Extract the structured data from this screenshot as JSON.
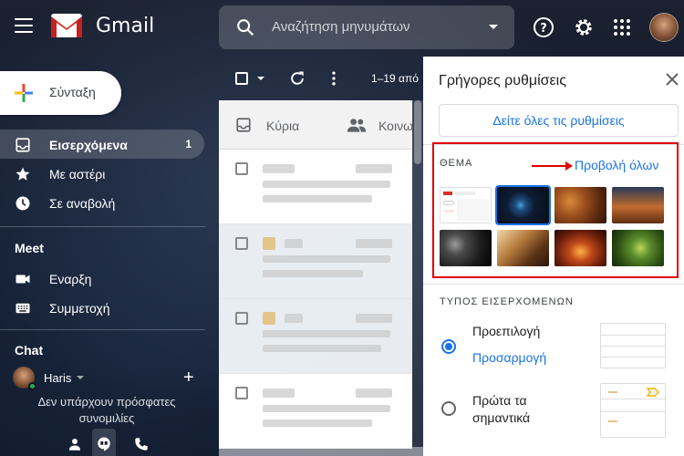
{
  "header": {
    "app_name": "Gmail",
    "search_placeholder": "Αναζήτηση μηνυμάτων"
  },
  "compose": {
    "label": "Σύνταξη"
  },
  "nav": {
    "items": [
      {
        "label": "Εισερχόμενα",
        "count": "1",
        "icon": "inbox-icon"
      },
      {
        "label": "Με αστέρι",
        "icon": "star-icon"
      },
      {
        "label": "Σε αναβολή",
        "icon": "clock-icon"
      }
    ]
  },
  "meet": {
    "title": "Meet",
    "items": [
      {
        "label": "Εναρξη",
        "icon": "video-icon"
      },
      {
        "label": "Συμμετοχή",
        "icon": "keyboard-icon"
      }
    ]
  },
  "chat": {
    "title": "Chat",
    "user": "Haris",
    "empty_text": "Δεν υπάρχουν πρόσφατες συνομιλίες"
  },
  "list": {
    "pagination": "1–19 από",
    "tabs": [
      {
        "label": "Κύρια",
        "icon": "inbox-tab-icon"
      },
      {
        "label": "Κοινω",
        "icon": "people-icon"
      }
    ]
  },
  "quick_settings": {
    "title": "Γρήγορες ρυθμίσεις",
    "see_all_button": "Δείτε όλες τις ρυθμίσεις",
    "theme_section": "ΘΕΜΑ",
    "view_all_link": "Προβολή όλων",
    "inbox_type_section": "ΤΥΠΟΣ ΕΙΣΕΡΧΟΜΕΝΩΝ",
    "options": [
      {
        "label": "Προεπιλογή",
        "link": "Προσαρμογή",
        "selected": true
      },
      {
        "label": "Πρώτα τα σημαντικά",
        "selected": false
      }
    ]
  },
  "colors": {
    "accent": "#1a73e8",
    "highlight": "#e00000"
  }
}
